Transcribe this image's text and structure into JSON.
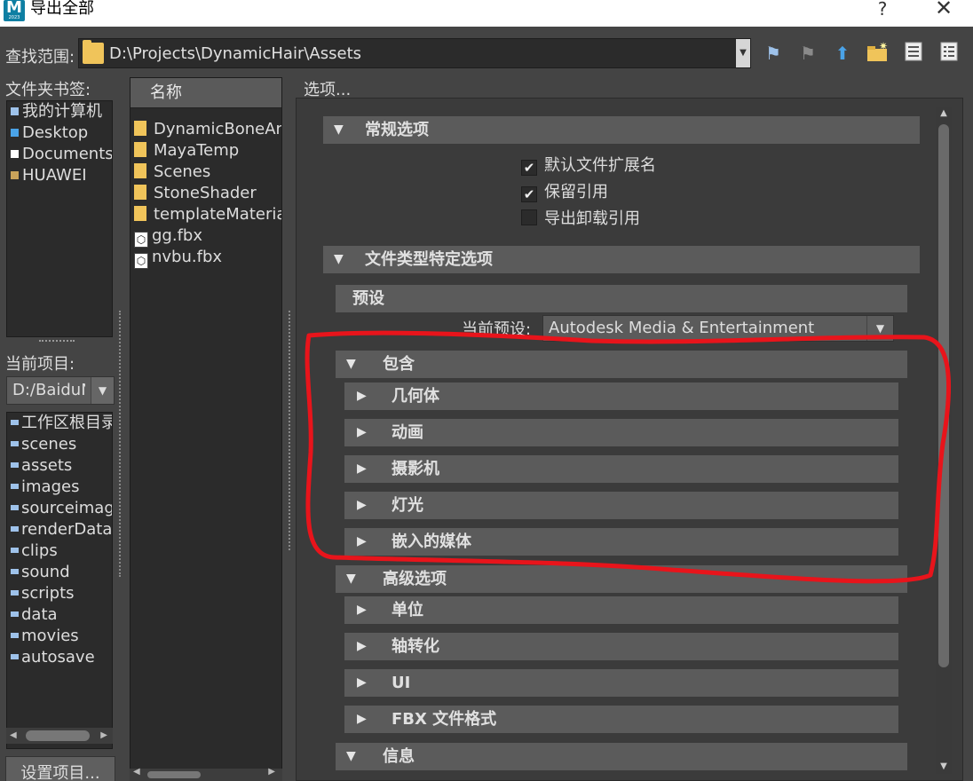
{
  "window": {
    "title": "导出全部",
    "icon_letter": "M",
    "icon_sub": "2023",
    "help_label": "?",
    "close_label": "✕"
  },
  "toolbar": {
    "look_in_label": "查找范围:",
    "path": "D:\\Projects\\DynamicHair\\Assets"
  },
  "bookmarks": {
    "label": "文件夹书签:",
    "items": [
      {
        "label": "我的计算机",
        "icon": "computer-icon",
        "color": "#9ec2ea"
      },
      {
        "label": "Desktop",
        "icon": "desktop-icon",
        "color": "#4aa3e8"
      },
      {
        "label": "Documents",
        "icon": "document-icon",
        "color": "#ffffff"
      },
      {
        "label": "HUAWEI",
        "icon": "user-folder-icon",
        "color": "#c9a35a"
      }
    ]
  },
  "project": {
    "label": "当前项目:",
    "current": "D:/BaiduN",
    "items": [
      "工作区根目录",
      "scenes",
      "assets",
      "images",
      "sourceimag",
      "renderData",
      "clips",
      "sound",
      "scripts",
      "data",
      "movies",
      "autosave"
    ],
    "set_button": "设置项目..."
  },
  "files": {
    "header": "名称",
    "items": [
      {
        "name": "DynamicBoneAn",
        "type": "folder"
      },
      {
        "name": "MayaTemp",
        "type": "folder"
      },
      {
        "name": "Scenes",
        "type": "folder"
      },
      {
        "name": "StoneShader",
        "type": "folder"
      },
      {
        "name": "templateMateria",
        "type": "folder"
      },
      {
        "name": "gg.fbx",
        "type": "fbx"
      },
      {
        "name": "nvbu.fbx",
        "type": "fbx"
      }
    ]
  },
  "options": {
    "label": "选项...",
    "general": {
      "title": "常规选项",
      "checkboxes": [
        {
          "label": "默认文件扩展名",
          "checked": true
        },
        {
          "label": "保留引用",
          "checked": true
        },
        {
          "label": "导出卸载引用",
          "checked": false
        }
      ]
    },
    "file_type": {
      "title": "文件类型特定选项",
      "preset": {
        "title": "预设",
        "label": "当前预设:",
        "value": "Autodesk Media & Entertainment"
      },
      "include": {
        "title": "包含",
        "items": [
          "几何体",
          "动画",
          "摄影机",
          "灯光",
          "嵌入的媒体"
        ]
      },
      "advanced": {
        "title": "高级选项",
        "items": [
          "单位",
          "轴转化",
          "UI",
          "FBX 文件格式"
        ]
      },
      "info": {
        "title": "信息"
      }
    }
  },
  "annotation_color": "#e8141b"
}
